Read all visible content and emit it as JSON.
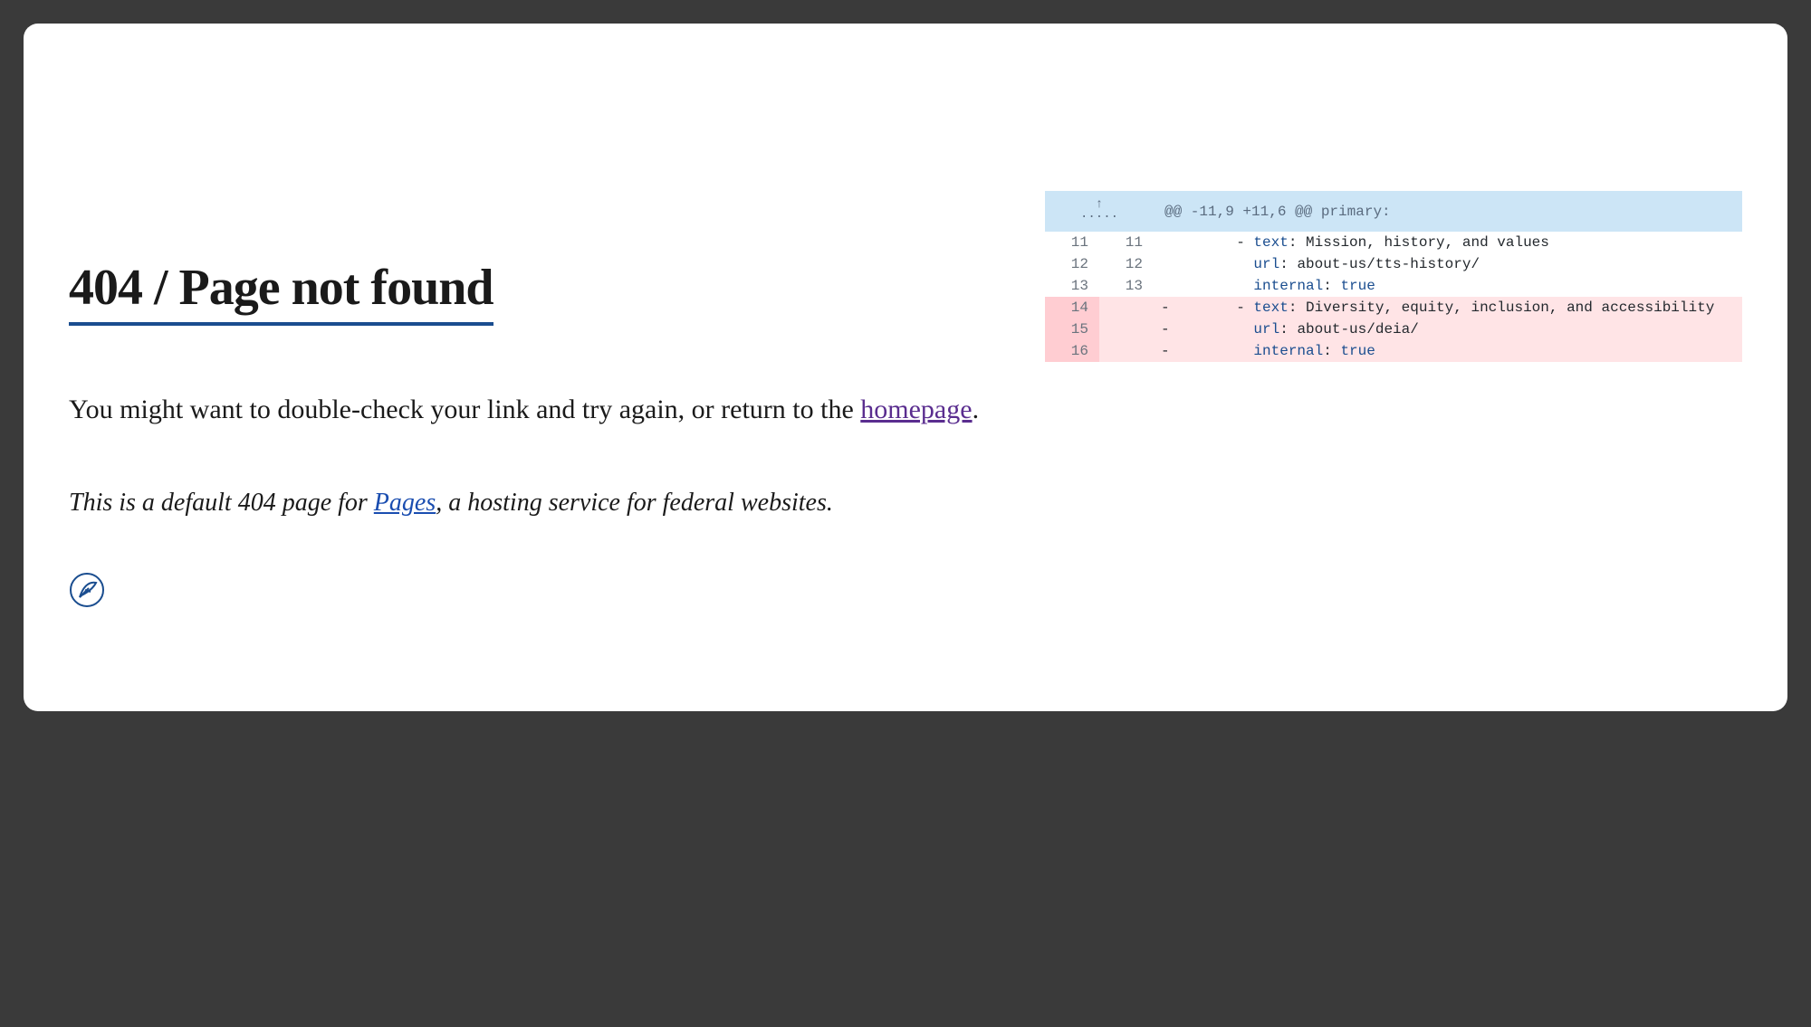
{
  "title": "404 / Page not found",
  "subtitle": {
    "before_link": "You might want to double-check your link and try again, or return to the ",
    "link_text": "homepage",
    "after_link": "."
  },
  "note": {
    "before_link": "This is a default 404 page for ",
    "link_text": "Pages",
    "after_link": ", a hosting service for federal websites."
  },
  "diff": {
    "hunk_header": "@@ -11,9 +11,6 @@ primary:",
    "expand_icon": "↑",
    "rows": [
      {
        "type": "context",
        "left": "11",
        "right": "11",
        "marker": "",
        "indent": "      ",
        "dash": "- ",
        "key": "text",
        "value": "Mission, history, and values"
      },
      {
        "type": "context",
        "left": "12",
        "right": "12",
        "marker": "",
        "indent": "        ",
        "dash": "",
        "key": "url",
        "value": "about-us/tts-history/"
      },
      {
        "type": "context",
        "left": "13",
        "right": "13",
        "marker": "",
        "indent": "        ",
        "dash": "",
        "key": "internal",
        "value": "true",
        "boolValue": true
      },
      {
        "type": "deleted",
        "left": "14",
        "right": "",
        "marker": "-",
        "indent": "      ",
        "dash": "- ",
        "key": "text",
        "value": "Diversity, equity, inclusion, and accessibility"
      },
      {
        "type": "deleted",
        "left": "15",
        "right": "",
        "marker": "-",
        "indent": "        ",
        "dash": "",
        "key": "url",
        "value": "about-us/deia/"
      },
      {
        "type": "deleted",
        "left": "16",
        "right": "",
        "marker": "-",
        "indent": "        ",
        "dash": "",
        "key": "internal",
        "value": "true",
        "boolValue": true
      }
    ]
  }
}
